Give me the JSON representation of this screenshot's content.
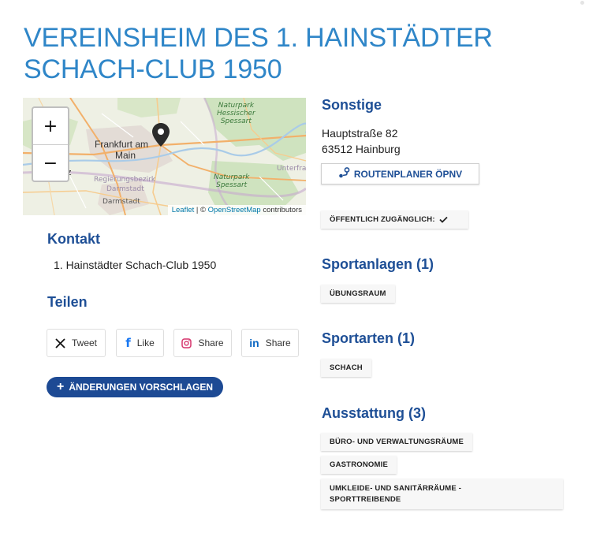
{
  "title": "VEREINSHEIM DES 1. HAINSTÄDTER SCHACH-CLUB 1950",
  "map": {
    "zoom_in_label": "+",
    "zoom_out_label": "−",
    "labels": {
      "frankfurt": "Frankfurt am",
      "main": "Main",
      "mainz": "nz",
      "naturpark_hessischer": [
        "Naturpark",
        "Hessischer",
        "Spessart"
      ],
      "naturpark_spessart": [
        "Naturpark",
        "Spessart"
      ],
      "regierungsbezirk": "Regierungsbezirk",
      "darmstadt_region": "Darmstadt",
      "darmstadt": "Darmstadt",
      "unterfranken": "Unterfra"
    },
    "attribution": {
      "leaflet": "Leaflet",
      "separator": " | © ",
      "osm": "OpenStreetMap",
      "contributors": " contributors"
    }
  },
  "kontakt": {
    "heading": "Kontakt",
    "name": "1. Hainstädter Schach-Club 1950"
  },
  "teilen": {
    "heading": "Teilen",
    "buttons": [
      {
        "label": "Tweet",
        "icon": "x-icon"
      },
      {
        "label": "Like",
        "icon": "facebook-icon"
      },
      {
        "label": "Share",
        "icon": "instagram-icon"
      },
      {
        "label": "Share",
        "icon": "linkedin-icon"
      }
    ]
  },
  "suggest_button": "ÄNDERUNGEN VORSCHLAGEN",
  "sonstige": {
    "heading": "Sonstige",
    "street": "Hauptstraße 82",
    "city": "63512 Hainburg",
    "route_button": "ROUTENPLANER ÖPNV",
    "public_tag": "ÖFFENTLICH ZUGÄNGLICH:"
  },
  "sportanlagen": {
    "heading": "Sportanlagen (1)",
    "items": [
      "ÜBUNGSRAUM"
    ]
  },
  "sportarten": {
    "heading": "Sportarten (1)",
    "items": [
      "SCHACH"
    ]
  },
  "ausstattung": {
    "heading": "Ausstattung (3)",
    "items": [
      "BÜRO- UND VERWALTUNGSRÄUME",
      "GASTRONOMIE",
      "UMKLEIDE- UND SANITÄRRÄUME -",
      "SPORTTREIBENDE"
    ]
  },
  "colors": {
    "title": "#2f86c8",
    "heading": "#1e4f96",
    "primary_button": "#1d4a94",
    "link": "#0078a8"
  }
}
